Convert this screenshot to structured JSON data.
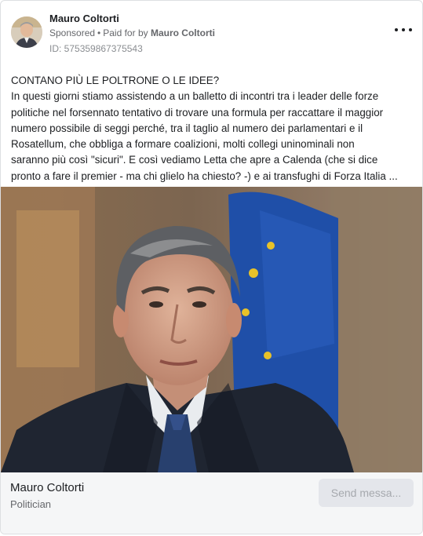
{
  "post": {
    "author": "Mauro Coltorti",
    "sponsored_label": "Sponsored",
    "paid_for_prefix": "Paid for by",
    "paid_for_by": "Mauro Coltorti",
    "library_id": "ID: 575359867375543",
    "more_icon": "more-horizontal-icon",
    "body_lines": [
      "CONTANO PIÙ LE POLTRONE O LE IDEE?",
      "In questi giorni stiamo assistendo a un balletto di incontri tra i leader delle forze",
      "politiche nel forsennato tentativo di trovare una formula per raccattare il maggior",
      "numero possibile di seggi perché, tra il taglio al numero dei parlamentari e il",
      "Rosatellum, che obbliga a formare coalizioni, molti collegi uninominali non",
      "saranno più così \"sicuri\". E così vediamo Letta che apre a Calenda (che si dice",
      "pronto a fare il premier - ma chi glielo ha chiesto? -) e ai transfughi di Forza Italia ..."
    ]
  },
  "footer": {
    "title": "Mauro Coltorti",
    "subtitle": "Politician",
    "cta_label": "Send messa..."
  },
  "colors": {
    "text": "#1c1e21",
    "secondary": "#65676b",
    "footer_bg": "#f5f6f7",
    "button_bg": "#e4e6eb",
    "eu_flag_blue": "#1f4fa8",
    "eu_star_yellow": "#e8c229"
  }
}
